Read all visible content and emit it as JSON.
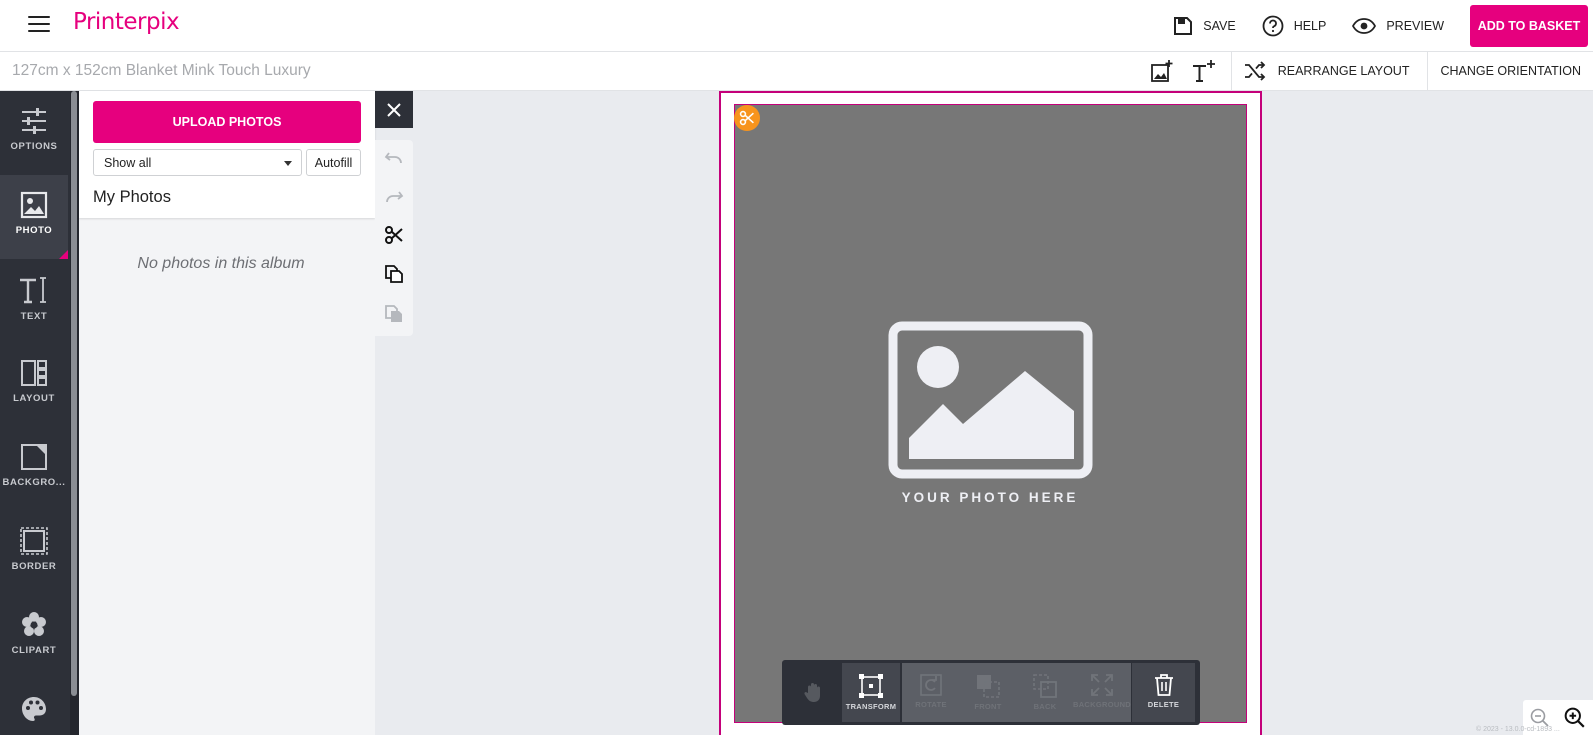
{
  "brand": {
    "logo_text": "Printerpix",
    "accent_color": "#e6007e"
  },
  "header": {
    "menu_icon": "hamburger-menu-icon",
    "actions": [
      {
        "icon": "save-icon",
        "label": "SAVE"
      },
      {
        "icon": "help-icon",
        "label": "HELP"
      },
      {
        "icon": "eye-icon",
        "label": "PREVIEW"
      }
    ],
    "basket_label": "ADD TO BASKET"
  },
  "subbar": {
    "product_title": "127cm x 152cm Blanket Mink Touch Luxury",
    "add_photo_icon": "add-photo-icon",
    "add_text_icon": "add-text-icon",
    "rearrange_label": "REARRANGE LAYOUT",
    "orientation_label": "CHANGE ORIENTATION"
  },
  "sidebar": {
    "items": [
      {
        "icon": "sliders-icon",
        "label": "OPTIONS"
      },
      {
        "icon": "photo-icon",
        "label": "PHOTO"
      },
      {
        "icon": "text-icon",
        "label": "TEXT"
      },
      {
        "icon": "layout-icon",
        "label": "LAYOUT"
      },
      {
        "icon": "background-icon",
        "label": "BACKGRO..."
      },
      {
        "icon": "border-icon",
        "label": "BORDER"
      },
      {
        "icon": "clipart-icon",
        "label": "CLIPART"
      },
      {
        "icon": "palette-icon",
        "label": ""
      }
    ],
    "active": "PHOTO"
  },
  "photos_panel": {
    "upload_label": "UPLOAD PHOTOS",
    "filter_value": "Show all",
    "autofill_label": "Autofill",
    "heading": "My Photos",
    "empty_message": "No photos in this album"
  },
  "tool_column": [
    "close-icon",
    "undo-icon",
    "redo-icon",
    "scissors-icon",
    "copy-icon",
    "paste-icon"
  ],
  "canvas": {
    "placeholder_text": "YOUR PHOTO HERE",
    "slot_color": "#777777",
    "frame_color": "#c4007a",
    "crop_badge_color": "#f7941d"
  },
  "bottom_toolbar": {
    "tools": [
      {
        "icon": "hand-icon",
        "label": ""
      },
      {
        "icon": "transform-icon",
        "label": "TRANSFORM"
      },
      {
        "icon": "rotate-icon",
        "label": "ROTATE"
      },
      {
        "icon": "front-icon",
        "label": "FRONT"
      },
      {
        "icon": "back-icon",
        "label": "BACK"
      },
      {
        "icon": "background-fit-icon",
        "label": "BACKGROUND"
      },
      {
        "icon": "trash-icon",
        "label": "DELETE"
      }
    ]
  },
  "zoom": {
    "out_icon": "zoom-out-icon",
    "in_icon": "zoom-in-icon"
  },
  "footer": {
    "version_text": "© 2023 - 13.0.0-cd-1893 ..."
  }
}
